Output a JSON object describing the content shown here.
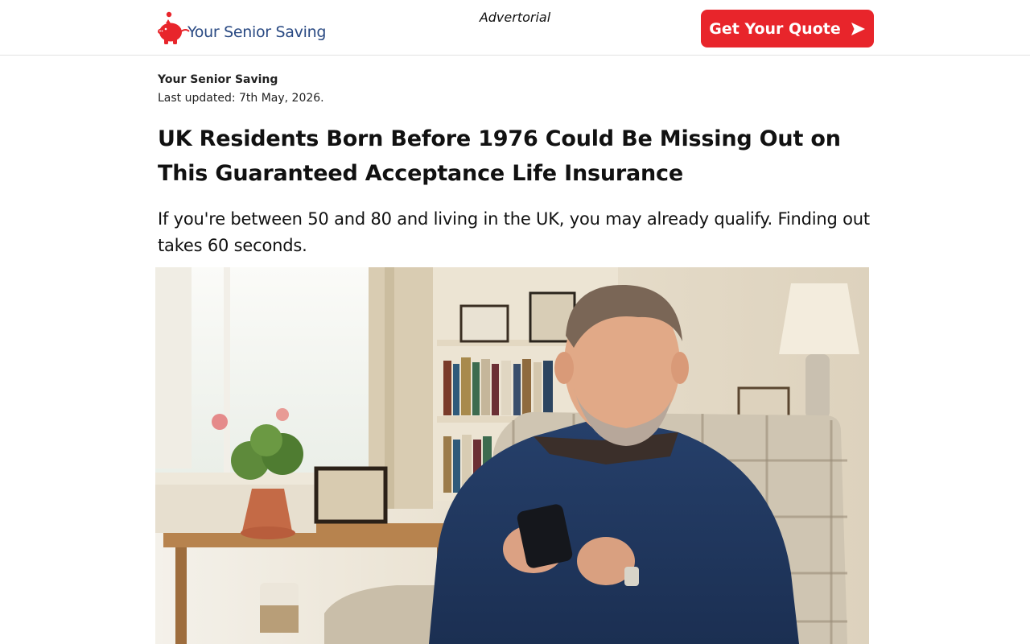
{
  "header": {
    "logo_text": "Your Senior Saving",
    "logo_icon": "piggy-bank-icon",
    "advertorial_label": "Advertorial",
    "cta_label": "Get Your Quote",
    "cta_icon": "send-arrow-icon",
    "brand_color": "#2a4a83",
    "accent_color": "#e8252b"
  },
  "article": {
    "author": "Your Senior Saving",
    "last_updated": "Last updated: 7th May, 2026.",
    "headline": "UK Residents Born Before 1976 Could Be Missing Out on This Guaranteed Acceptance Life Insurance",
    "lede": "If you're between 50 and 80 and living in the UK, you may already qualify. Finding out takes 60 seconds.",
    "hero_image": "older-man-using-smartphone-in-armchair"
  }
}
